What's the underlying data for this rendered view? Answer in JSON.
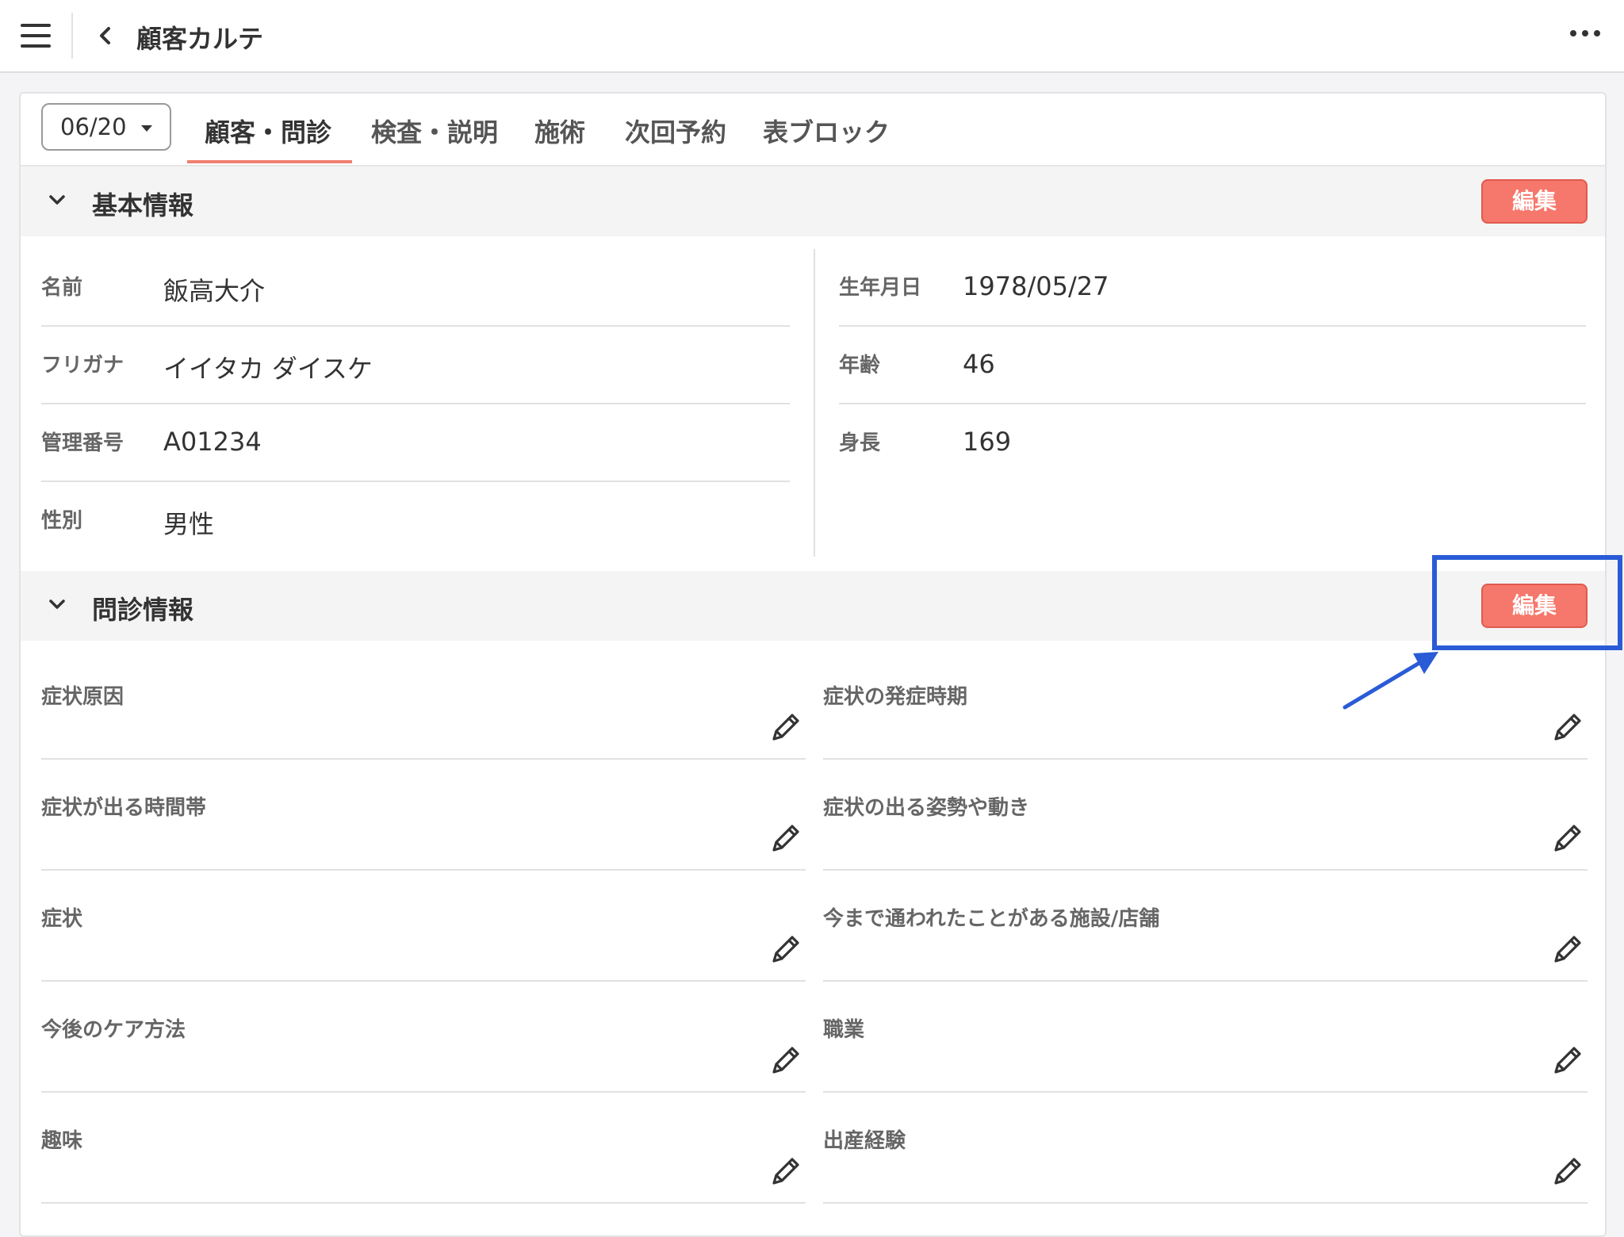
{
  "header": {
    "title": "顧客カルテ"
  },
  "tabs": {
    "date": "06/20",
    "items": [
      "顧客・問診",
      "検査・説明",
      "施術",
      "次回予約",
      "表ブロック"
    ]
  },
  "basic": {
    "title": "基本情報",
    "edit_label": "編集",
    "left": [
      {
        "label": "名前",
        "value": "飯高大介"
      },
      {
        "label": "フリガナ",
        "value": "イイタカ ダイスケ"
      },
      {
        "label": "管理番号",
        "value": "A01234"
      },
      {
        "label": "性別",
        "value": "男性"
      }
    ],
    "right": [
      {
        "label": "生年月日",
        "value": "1978/05/27"
      },
      {
        "label": "年齢",
        "value": "46"
      },
      {
        "label": "身長",
        "value": "169"
      }
    ]
  },
  "inquiry": {
    "title": "問診情報",
    "edit_label": "編集",
    "items": [
      "症状原因",
      "症状の発症時期",
      "症状が出る時間帯",
      "症状の出る姿勢や動き",
      "症状",
      "今まで通われたことがある施設/店舗",
      "今後のケア方法",
      "職業",
      "趣味",
      "出産経験"
    ]
  },
  "annotation": {
    "color": "#2a5bd7"
  },
  "colors": {
    "accent": "#f6776b",
    "tab_underline": "#f08070"
  },
  "icons": [
    "menu-icon",
    "back-chevron-icon",
    "more-icon",
    "chevron-down-icon",
    "pencil-icon"
  ]
}
